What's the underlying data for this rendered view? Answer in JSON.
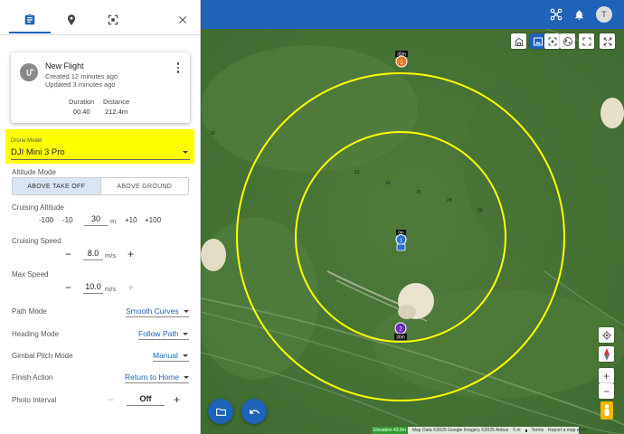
{
  "panel": {
    "flight": {
      "name": "New Flight",
      "created": "Created   12 minutes ago",
      "updated": "Updated   3 minutes ago",
      "duration_label": "Duration",
      "duration_value": "00:40",
      "distance_label": "Distance",
      "distance_value": "212.4m"
    },
    "drone_model": {
      "label": "Drone Model",
      "value": "DJI Mini 3 Pro"
    },
    "altitude_mode": {
      "label": "Altitude Mode",
      "options": [
        "ABOVE TAKE OFF",
        "ABOVE GROUND"
      ],
      "selected": "ABOVE TAKE OFF"
    },
    "cruising_altitude": {
      "label": "Cruising Altitude",
      "steps": [
        "-100",
        "-10",
        "+10",
        "+100"
      ],
      "value": "30",
      "unit": "m"
    },
    "cruising_speed": {
      "label": "Cruising Speed",
      "value": "8.0",
      "unit": "m/s"
    },
    "max_speed": {
      "label": "Max Speed",
      "value": "10.0",
      "unit": "m/s"
    },
    "path_mode": {
      "label": "Path Mode",
      "value": "Smooth Curves"
    },
    "heading_mode": {
      "label": "Heading Mode",
      "value": "Follow Path"
    },
    "gimbal_pitch_mode": {
      "label": "Gimbal Pitch Mode",
      "value": "Manual"
    },
    "finish_action": {
      "label": "Finish Action",
      "value": "Return to Home"
    },
    "photo_interval": {
      "label": "Photo Interval",
      "value": "Off"
    },
    "minus": "−",
    "plus": "+"
  },
  "topbar": {
    "avatar_initial": "T"
  },
  "map": {
    "waypoints": [
      {
        "number": "1",
        "altitude": "30m",
        "color": "#e8782a"
      },
      {
        "number": "2",
        "altitude": "30m",
        "color": "#6a2bb8"
      }
    ],
    "home": {
      "number": "1",
      "altitude": "0m"
    },
    "labels": [
      "22",
      "24",
      "26",
      "28",
      "30",
      "18"
    ],
    "colors": {
      "path": "#ffff00",
      "accent": "#1e63b8"
    }
  },
  "attribution": {
    "elevation": "Elevation 43.9m",
    "data": "Map Data ©2025 Google Imagery ©2025 Airbus",
    "scale": "5 m",
    "terms": "Terms",
    "report": "Report a map error"
  }
}
